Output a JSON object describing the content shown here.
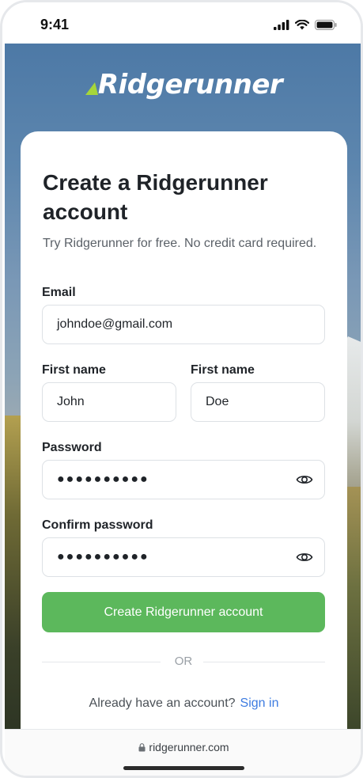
{
  "status_bar": {
    "time": "9:41"
  },
  "brand": {
    "name": "Ridgerunner",
    "accent": "#a6d63a"
  },
  "form": {
    "title": "Create a Ridgerunner account",
    "subtitle": "Try Ridgerunner for free. No credit card required.",
    "email": {
      "label": "Email",
      "value": "johndoe@gmail.com"
    },
    "first_name": {
      "label": "First name",
      "value": "John"
    },
    "last_name": {
      "label": "First name",
      "value": "Doe"
    },
    "password": {
      "label": "Password",
      "value": "●●●●●●●●●●"
    },
    "confirm_password": {
      "label": "Confirm password",
      "value": "●●●●●●●●●●"
    },
    "submit_label": "Create Ridgerunner account",
    "divider_text": "OR",
    "signin_prompt": "Already have an account?",
    "signin_link": "Sign in"
  },
  "browser": {
    "url": "ridgerunner.com"
  },
  "colors": {
    "primary_button": "#5cb85c",
    "link": "#3d7be0"
  }
}
